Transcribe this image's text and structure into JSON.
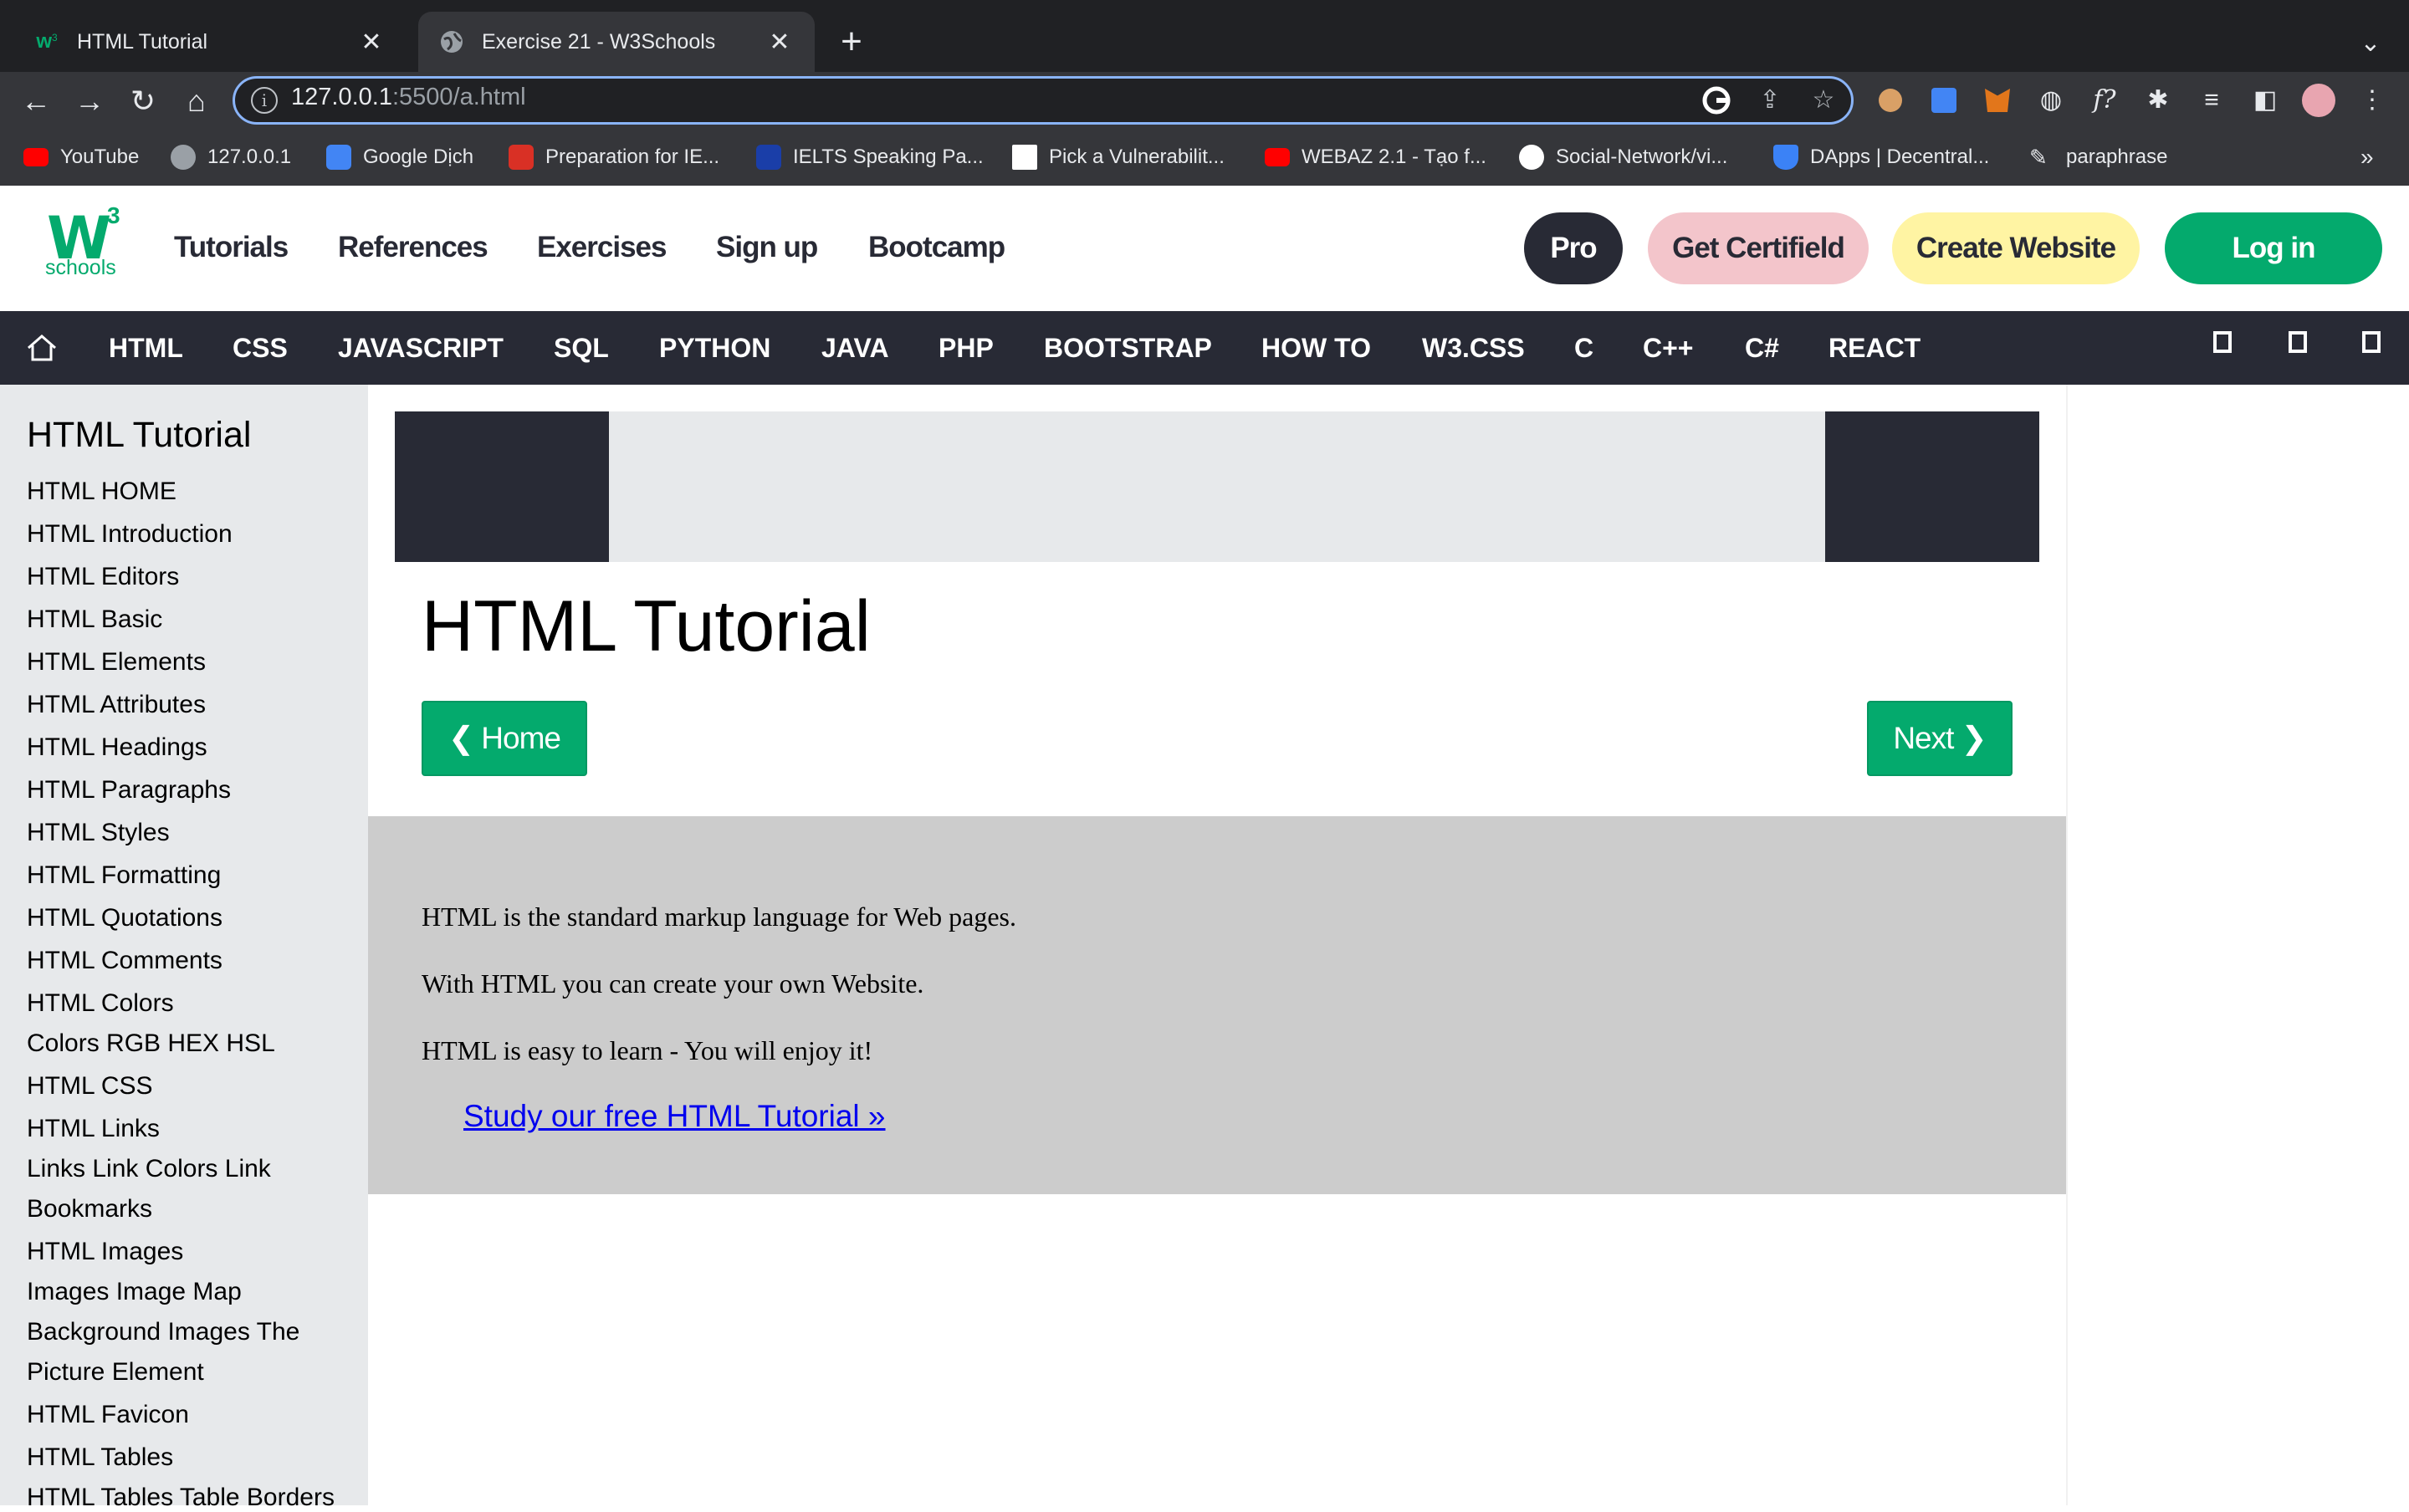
{
  "browser": {
    "tabs": [
      {
        "title": "HTML Tutorial",
        "favicon": "w3schools-favicon"
      },
      {
        "title": "Exercise 21 - W3Schools",
        "favicon": "globe-icon"
      }
    ],
    "url_host": "127.0.0.1",
    "url_rest": ":5500/a.html",
    "bookmarks": [
      {
        "label": "YouTube",
        "color": "#ff0000"
      },
      {
        "label": "127.0.0.1",
        "color": "#9aa0a6"
      },
      {
        "label": "Google Dịch",
        "color": "#4285f4"
      },
      {
        "label": "Preparation for IE...",
        "color": "#d93025"
      },
      {
        "label": "IELTS Speaking Pa...",
        "color": "#1a3ea8"
      },
      {
        "label": "Pick a Vulnerabilit...",
        "color": "#ffffff"
      },
      {
        "label": "WEBAZ 2.1 - Tạo f...",
        "color": "#ff0000"
      },
      {
        "label": "Social-Network/vi...",
        "color": "#ffffff"
      },
      {
        "label": "DApps | Decentral...",
        "color": "#3b82f6"
      },
      {
        "label": "paraphrase",
        "color": "#e8eaed"
      }
    ],
    "bookmarks_overflow": "»",
    "new_tab": "+",
    "tab_close": "✕"
  },
  "header": {
    "logo_w": "W",
    "logo_3": "3",
    "logo_text": "schools",
    "nav": [
      "Tutorials",
      "References",
      "Exercises",
      "Sign up",
      "Bootcamp"
    ],
    "pro": "Pro",
    "certified": "Get Certifield",
    "create_website": "Create Website",
    "login": "Log in"
  },
  "subnav": {
    "items": [
      "HTML",
      "CSS",
      "JAVASCRIPT",
      "SQL",
      "PYTHON",
      "JAVA",
      "PHP",
      "BOOTSTRAP",
      "HOW TO",
      "W3.CSS",
      "C",
      "C++",
      "C#",
      "REACT"
    ]
  },
  "sidebar": {
    "title": "HTML Tutorial",
    "links": [
      "HTML HOME",
      "HTML Introduction",
      "HTML Editors",
      "HTML Basic",
      "HTML Elements",
      "HTML Attributes",
      "HTML Headings",
      "HTML Paragraphs",
      "HTML Styles",
      "HTML Formatting",
      "HTML Quotations",
      "HTML Comments",
      "HTML Colors",
      "Colors RGB HEX HSL",
      "HTML CSS",
      "HTML Links",
      "Links Link Colors Link",
      "Bookmarks",
      "HTML Images",
      "Images Image Map",
      "Background Images The",
      "Picture Element",
      "HTML Favicon",
      "HTML Tables",
      "HTML Tables Table Borders"
    ]
  },
  "main": {
    "title": "HTML Tutorial",
    "home_button": "❮ Home",
    "next_button": "Next ❯",
    "intro": [
      "HTML is the standard markup language for Web pages.",
      "With HTML you can create your own Website.",
      "HTML is easy to learn - You will enjoy it!"
    ],
    "study_link": "Study our free HTML Tutorial »"
  }
}
